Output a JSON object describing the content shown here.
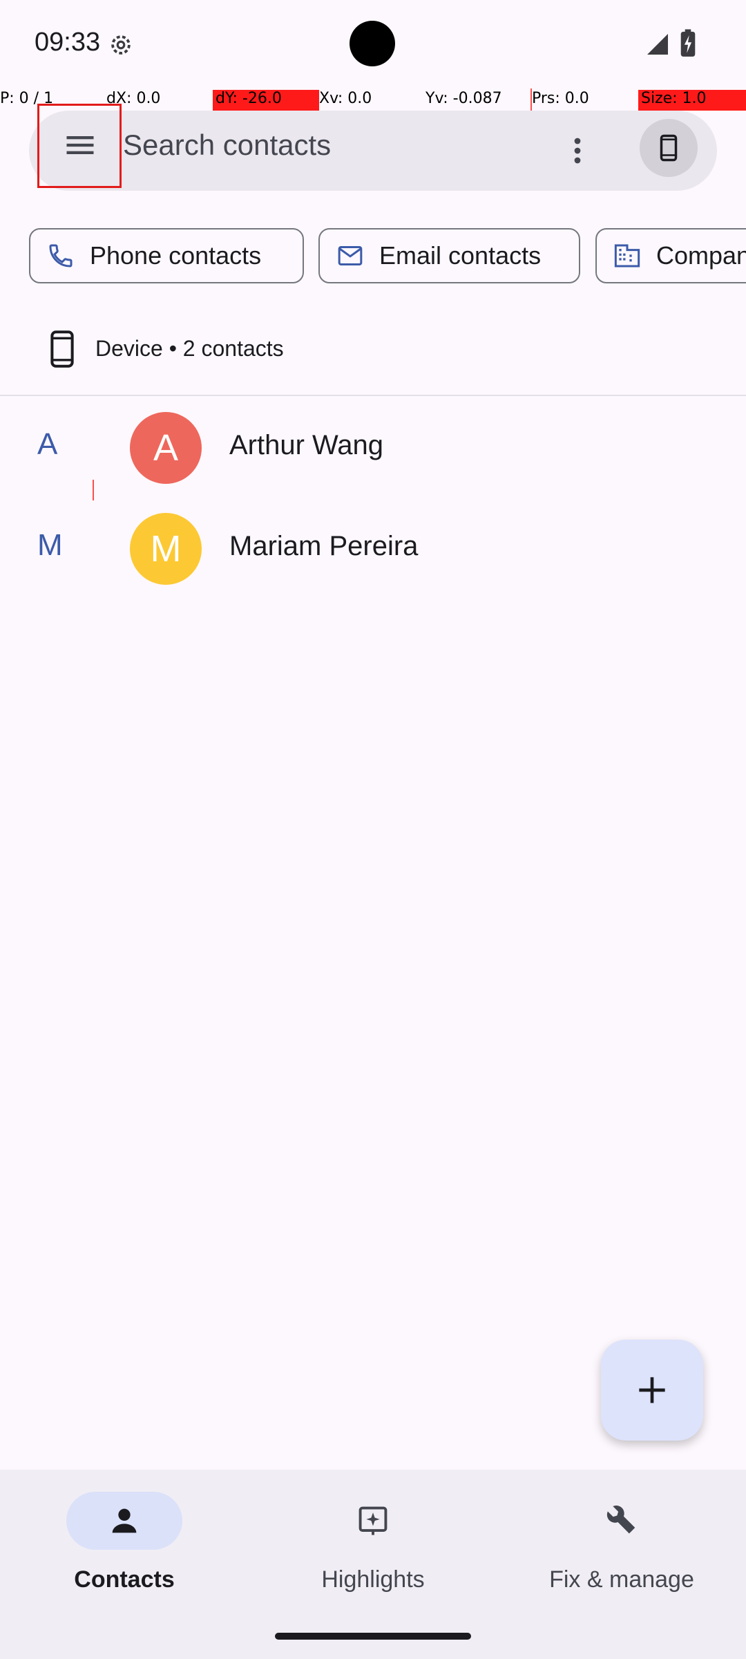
{
  "status_bar": {
    "time": "09:33",
    "icons": [
      "settings-gear-icon",
      "cell-signal-icon",
      "battery-charging-icon"
    ]
  },
  "debug_overlay": {
    "p": "P: 0 / 1",
    "dx": "dX: 0.0",
    "dy": "dY: -26.0",
    "xv": "Xv: 0.0",
    "yv": "Yv: -0.087",
    "prs": "Prs: 0.0",
    "size": "Size: 1.0"
  },
  "search": {
    "placeholder": "Search contacts",
    "menu_icon": "hamburger-menu-icon",
    "more_icon": "more-vert-icon",
    "account_icon": "phone-device-icon"
  },
  "filters": [
    {
      "label": "Phone contacts",
      "icon": "phone-icon"
    },
    {
      "label": "Email contacts",
      "icon": "mail-icon"
    },
    {
      "label": "Compan",
      "icon": "business-icon"
    }
  ],
  "account": {
    "label": "Device • 2 contacts",
    "icon": "phone-device-icon"
  },
  "contacts": [
    {
      "letter": "A",
      "initial": "A",
      "name": "Arthur Wang",
      "avatar_color": "#ee675c"
    },
    {
      "letter": "M",
      "initial": "M",
      "name": "Mariam Pereira",
      "avatar_color": "#fcc934"
    }
  ],
  "fab": {
    "icon": "add-icon"
  },
  "bottom_nav": [
    {
      "label": "Contacts",
      "icon": "person-icon",
      "active": true
    },
    {
      "label": "Highlights",
      "icon": "highlights-icon",
      "active": false
    },
    {
      "label": "Fix & manage",
      "icon": "wrench-icon",
      "active": false
    }
  ],
  "colors": {
    "accent": "#3c5ba9",
    "background": "#fdf8fd",
    "search_bg": "#ebe7ee",
    "fab_bg": "#dde3fb",
    "nav_bg": "#f0eef4"
  }
}
